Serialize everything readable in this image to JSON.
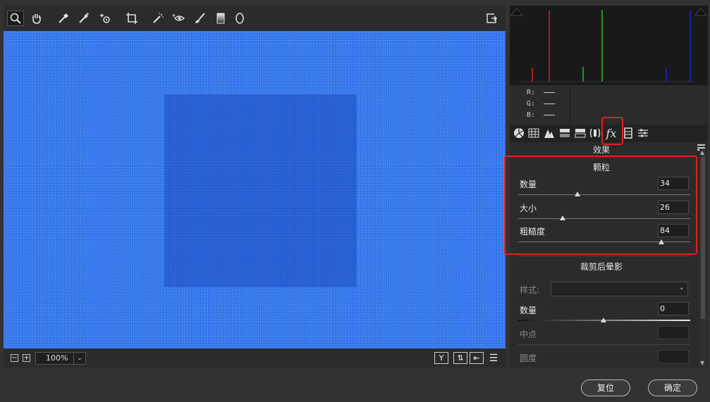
{
  "toolbar": {
    "tools": [
      "zoom-icon",
      "hand-icon",
      "white-balance-icon",
      "color-sampler-icon",
      "targeted-adjustment-icon",
      "crop-icon",
      "spot-removal-icon",
      "red-eye-icon",
      "adjustment-brush-icon",
      "graduated-filter-icon",
      "radial-filter-icon",
      "open-preferences-icon"
    ]
  },
  "histogram": {
    "r_label": "R:",
    "g_label": "G:",
    "b_label": "B:"
  },
  "tabs": [
    "basic-icon",
    "tone-curve-icon",
    "detail-icon",
    "hsl-icon",
    "split-toning-icon",
    "lens-corrections-icon",
    "fx-icon",
    "camera-calibration-icon",
    "presets-icon"
  ],
  "section": {
    "title": "效果"
  },
  "grain": {
    "title": "颗粒",
    "amount_label": "数量",
    "amount_value": "34",
    "size_label": "大小",
    "size_value": "26",
    "roughness_label": "粗糙度",
    "roughness_value": "84"
  },
  "vignette": {
    "title": "裁剪后晕影",
    "style_label": "样式:",
    "amount_label": "数量",
    "amount_value": "0",
    "midpoint_label": "中点",
    "roundness_label": "圆度"
  },
  "zoom": {
    "value": "100%"
  },
  "buttons": {
    "reset": "复位",
    "ok": "确定"
  },
  "colors": {
    "highlight": "#e42020",
    "canvas_blue": "#3478ef",
    "square_blue": "#2660d6"
  }
}
